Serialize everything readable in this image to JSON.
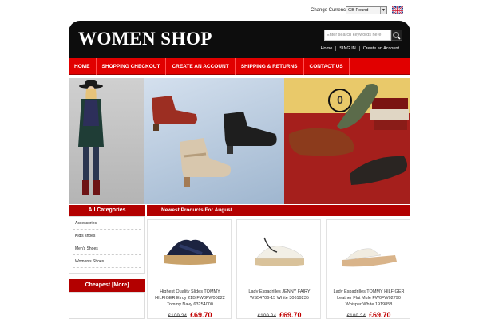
{
  "currency": {
    "label": "Change Currency:",
    "selected": "GB Pound"
  },
  "header": {
    "logo": "WOMEN SHOP",
    "search_placeholder": "Enter search keywords here",
    "links": [
      "Home",
      "SING IN",
      "Create an Account"
    ]
  },
  "nav": [
    "HOME",
    "SHOPPING CHECKOUT",
    "CREATE AN ACCOUNT",
    "SHIPPING & RETURNS",
    "CONTACT US"
  ],
  "sidebar": {
    "categories_title": "All Categories",
    "categories": [
      "Accessories",
      "Kid's shoes",
      "Men's Shoes",
      "Women's Shoes"
    ],
    "cheapest_title": "Cheapest  [More]"
  },
  "main": {
    "title": "Newest Products For August",
    "products": [
      {
        "name": "Highest Quality Slides TOMMY HILFIGER Elroy 21B FW0FW00822 Tommy Navy 63254000",
        "old_price": "£109.24",
        "new_price": "£69.70"
      },
      {
        "name": "Lady Espadrilles JENNY FAIRY WS54706-15 White 30619235",
        "old_price": "£109.24",
        "new_price": "£69.70"
      },
      {
        "name": "Lady Espadrilles TOMMY HILFIGER Leather Flat Mule FW0FW02790 Whisper White 1919858",
        "old_price": "£109.24",
        "new_price": "£69.70"
      }
    ]
  },
  "banner": {
    "badge": "0"
  },
  "colors": {
    "accent": "#e10000",
    "dark_red": "#b30000",
    "header_bg": "#0d0d0d",
    "price": "#c00000"
  }
}
